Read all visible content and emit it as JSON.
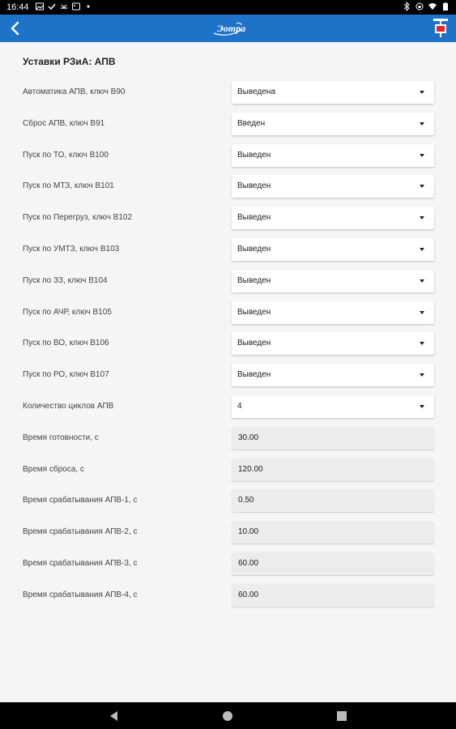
{
  "status_bar": {
    "time": "16:44",
    "left_icons": [
      "image-icon",
      "check-icon",
      "missed-call-icon",
      "gallery-icon",
      "dot-icon"
    ],
    "right_icons": [
      "bluetooth-icon",
      "lock-rotation-icon",
      "wifi-icon",
      "battery-icon"
    ]
  },
  "app_bar": {
    "logo_text": "Эотра",
    "back_icon": "chevron-left-icon",
    "action_icon": "device-icon",
    "color": "#1e73c8"
  },
  "section": {
    "title": "Уставки РЗиА: АПВ"
  },
  "settings": [
    {
      "label": "Автоматика АПВ, ключ В90",
      "value": "Выведена",
      "kind": "select"
    },
    {
      "label": "Сброс АПВ, ключ В91",
      "value": "Введен",
      "kind": "select"
    },
    {
      "label": "Пуск по ТО, ключ В100",
      "value": "Выведен",
      "kind": "select"
    },
    {
      "label": "Пуск по МТЗ, ключ В101",
      "value": "Выведен",
      "kind": "select"
    },
    {
      "label": "Пуск по Перегруз, ключ В102",
      "value": "Выведен",
      "kind": "select"
    },
    {
      "label": "Пуск по УМТЗ, ключ В103",
      "value": "Выведен",
      "kind": "select"
    },
    {
      "label": "Пуск по ЗЗ, ключ В104",
      "value": "Выведен",
      "kind": "select"
    },
    {
      "label": "Пуск по АЧР, ключ В105",
      "value": "Выведен",
      "kind": "select"
    },
    {
      "label": "Пуск по ВО, ключ В106",
      "value": "Выведен",
      "kind": "select"
    },
    {
      "label": "Пуск по РО, ключ В107",
      "value": "Выведен",
      "kind": "select"
    },
    {
      "label": "Количество циклов АПВ",
      "value": "4",
      "kind": "select"
    },
    {
      "label": "Время готовности, с",
      "value": "30.00",
      "kind": "input"
    },
    {
      "label": "Время сброса, с",
      "value": "120.00",
      "kind": "input"
    },
    {
      "label": "Время срабатывания АПВ-1, с",
      "value": "0.50",
      "kind": "input"
    },
    {
      "label": "Время срабатывания АПВ-2, с",
      "value": "10.00",
      "kind": "input"
    },
    {
      "label": "Время срабатывания АПВ-3, с",
      "value": "60.00",
      "kind": "input"
    },
    {
      "label": "Время срабатывания АПВ-4, с",
      "value": "60.00",
      "kind": "input"
    }
  ],
  "nav_bar": {
    "buttons": [
      "back-triangle-icon",
      "home-circle-icon",
      "recents-square-icon"
    ]
  }
}
